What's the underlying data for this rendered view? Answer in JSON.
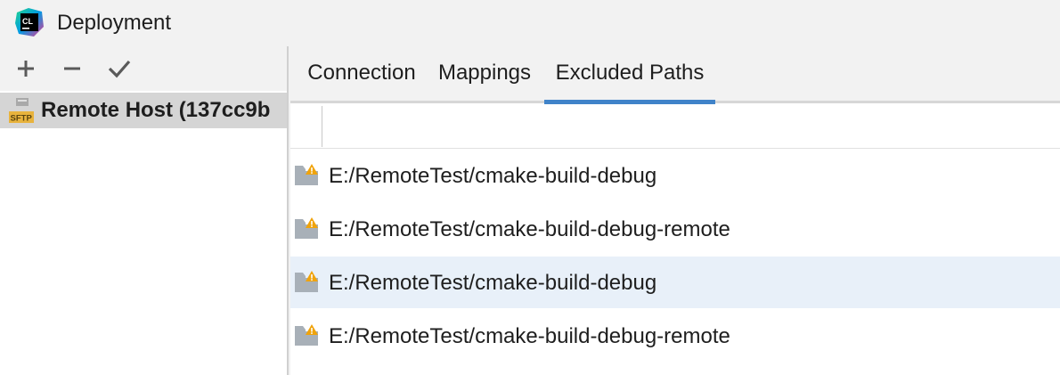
{
  "window": {
    "title": "Deployment",
    "logo_icon": "clion-logo-icon",
    "logo_text": "CL"
  },
  "left_toolbar": {
    "buttons": [
      {
        "icon": "plus-icon",
        "label": "+"
      },
      {
        "icon": "minus-icon",
        "label": "−"
      },
      {
        "icon": "checkmark-icon",
        "label": "✓"
      }
    ]
  },
  "servers": [
    {
      "name": "Remote Host (137cc9b",
      "type_badge": "SFTP",
      "selected": true
    }
  ],
  "tabs": [
    {
      "label": "Connection",
      "active": false
    },
    {
      "label": "Mappings",
      "active": false
    },
    {
      "label": "Excluded Paths",
      "active": true
    }
  ],
  "excluded_paths": [
    {
      "path": "E:/RemoteTest/cmake-build-debug",
      "icon": "local-folder-warning-icon",
      "selected": false
    },
    {
      "path": "E:/RemoteTest/cmake-build-debug-remote",
      "icon": "local-folder-warning-icon",
      "selected": false
    },
    {
      "path": "E:/RemoteTest/cmake-build-debug",
      "icon": "local-folder-warning-icon",
      "selected": true
    },
    {
      "path": "E:/RemoteTest/cmake-build-debug-remote",
      "icon": "local-folder-warning-icon",
      "selected": false
    }
  ],
  "colors": {
    "accent": "#4083c9",
    "selection_left": "#d5d5d5",
    "selection_right": "#e8f0f9",
    "warning": "#f0a30a"
  }
}
